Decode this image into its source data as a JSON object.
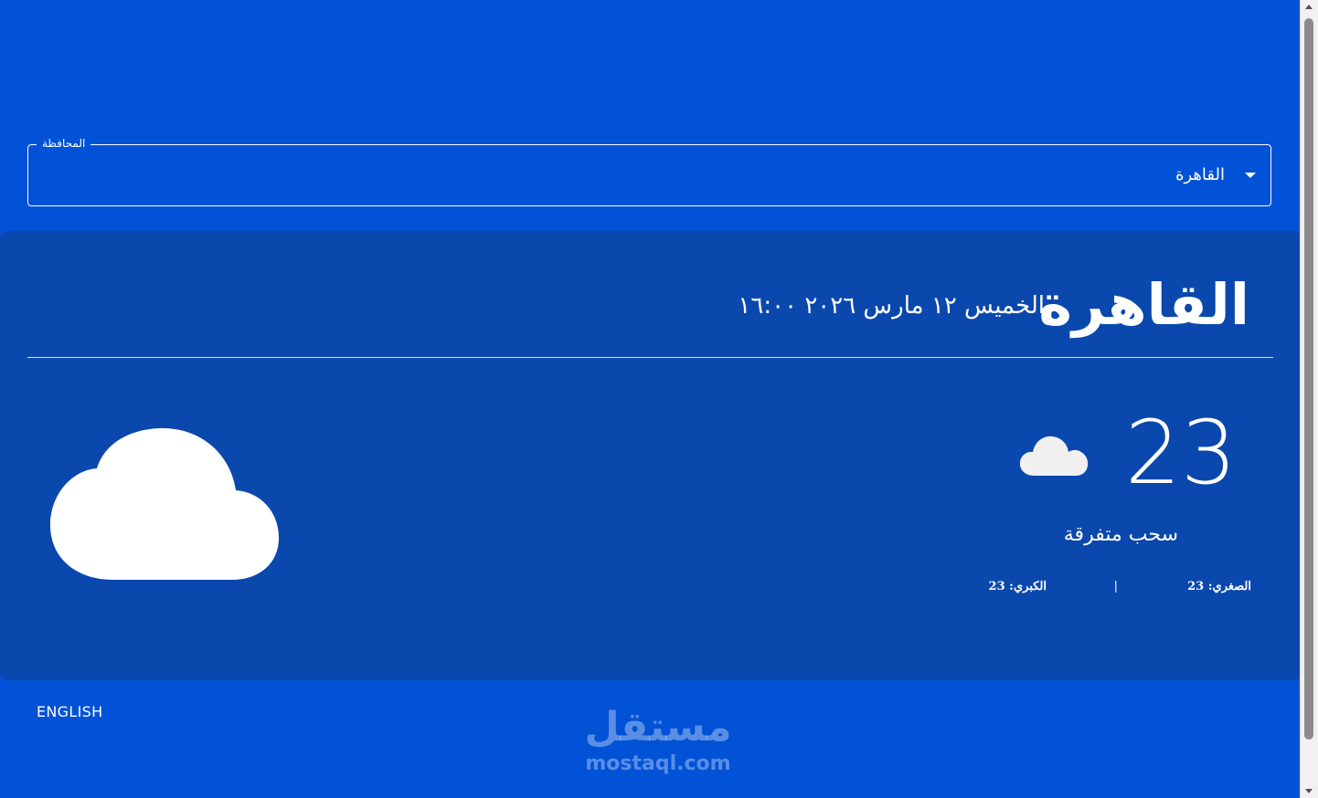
{
  "select": {
    "label": "المحافظة",
    "value": "القاهرة"
  },
  "weather": {
    "city": "القاهرة",
    "date": "الخميس ١٢ مارس ٢٠٢٦ ١٦:٠٠",
    "temperature": "23",
    "description": "سحب متفرقة",
    "min_label": "الصغري: 23",
    "separator": "|",
    "max_label": "الكبري: 23",
    "icon": "cloud-icon"
  },
  "footer": {
    "language_link": "ENGLISH",
    "watermark_ar": "مستقل",
    "watermark_en": "mostaql.com"
  },
  "colors": {
    "page_background": "#0152d6",
    "card_background": "#0a48ad",
    "text": "#ffffff"
  }
}
